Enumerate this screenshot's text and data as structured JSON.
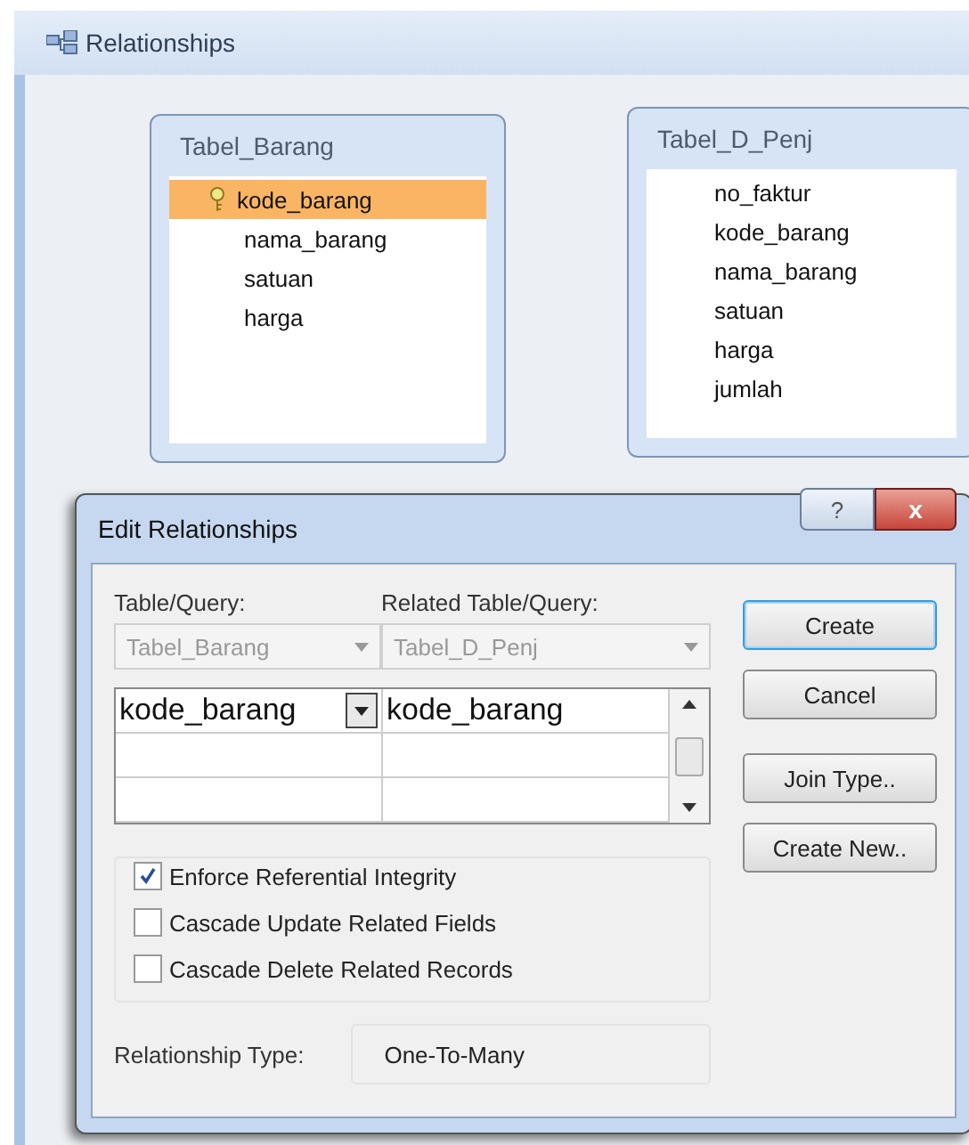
{
  "window": {
    "title": "Relationships"
  },
  "tables": [
    {
      "title": "Tabel_Barang",
      "fields": [
        {
          "name": "kode_barang",
          "selected": true,
          "primary_key": true
        },
        {
          "name": "nama_barang",
          "selected": false,
          "primary_key": false
        },
        {
          "name": "satuan",
          "selected": false,
          "primary_key": false
        },
        {
          "name": "harga",
          "selected": false,
          "primary_key": false
        }
      ]
    },
    {
      "title": "Tabel_D_Penj",
      "fields": [
        {
          "name": "no_faktur",
          "selected": false,
          "primary_key": false
        },
        {
          "name": "kode_barang",
          "selected": false,
          "primary_key": false
        },
        {
          "name": "nama_barang",
          "selected": false,
          "primary_key": false
        },
        {
          "name": "satuan",
          "selected": false,
          "primary_key": false
        },
        {
          "name": "harga",
          "selected": false,
          "primary_key": false
        },
        {
          "name": "jumlah",
          "selected": false,
          "primary_key": false
        }
      ]
    }
  ],
  "dialog": {
    "title": "Edit Relationships",
    "help": "?",
    "close": "x",
    "table_label": "Table/Query:",
    "related_label": "Related Table/Query:",
    "table_value": "Tabel_Barang",
    "related_value": "Tabel_D_Penj",
    "field_rows": [
      {
        "field": "kode_barang",
        "related_field": "kode_barang"
      }
    ],
    "buttons": [
      {
        "label": "Create",
        "default": true
      },
      {
        "label": "Cancel",
        "default": false
      },
      {
        "label": "Join Type..",
        "default": false
      },
      {
        "label": "Create New..",
        "default": false
      }
    ],
    "options": [
      {
        "label": "Enforce Referential Integrity",
        "checked": true
      },
      {
        "label": "Cascade Update Related Fields",
        "checked": false
      },
      {
        "label": "Cascade Delete Related Records",
        "checked": false
      }
    ],
    "relationship_type_label": "Relationship Type:",
    "relationship_type": "One-To-Many"
  }
}
